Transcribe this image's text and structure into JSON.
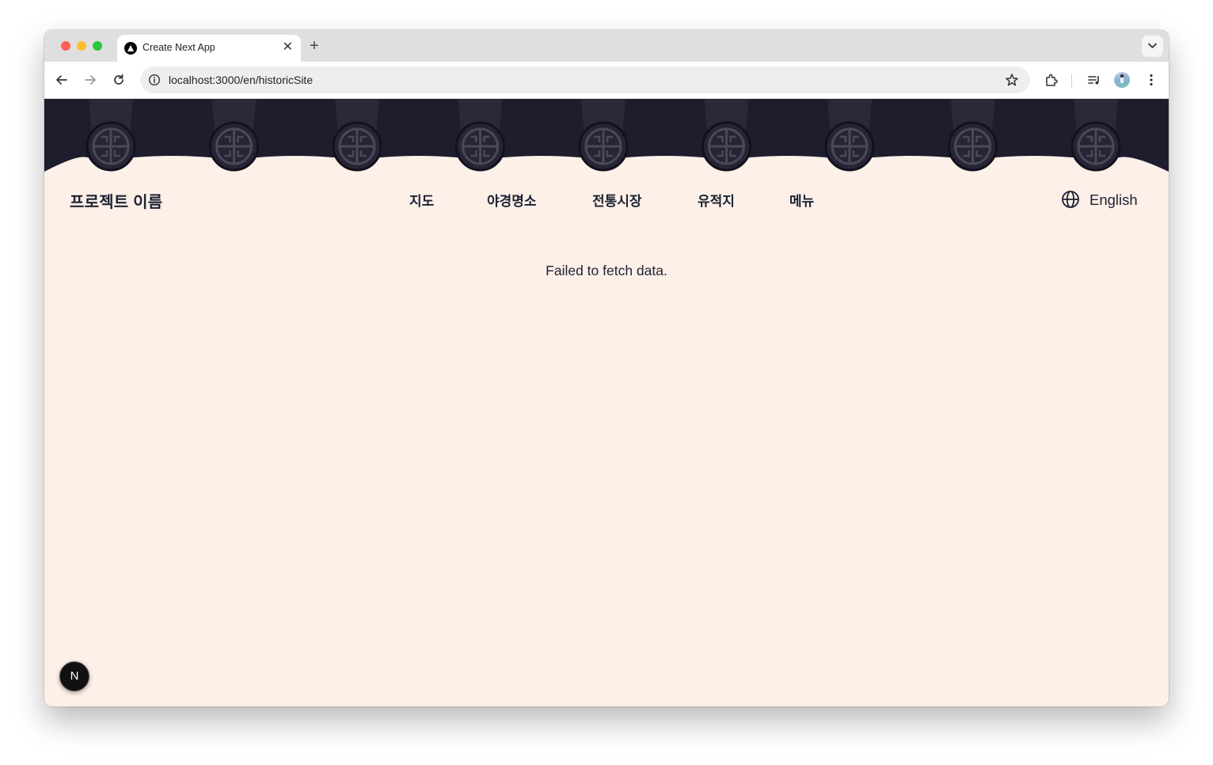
{
  "browser": {
    "tab_title": "Create Next App",
    "tab_close": "✕",
    "new_tab": "+",
    "url": "localhost:3000/en/historicSite"
  },
  "header": {
    "brand": "프로젝트 이름",
    "nav": [
      "지도",
      "야경명소",
      "전통시장",
      "유적지",
      "메뉴"
    ],
    "language": "English"
  },
  "main": {
    "message": "Failed to fetch data."
  },
  "dev_badge": {
    "letter": "N"
  },
  "colors": {
    "page_bg": "#fdf0e8",
    "roof": "#1e1d2e",
    "text": "#1d2233"
  },
  "icons": [
    "back-icon",
    "forward-icon",
    "reload-icon",
    "info-icon",
    "star-icon",
    "extensions-icon",
    "media-control-icon",
    "kebab-menu-icon",
    "globe-icon",
    "nextjs-icon"
  ]
}
